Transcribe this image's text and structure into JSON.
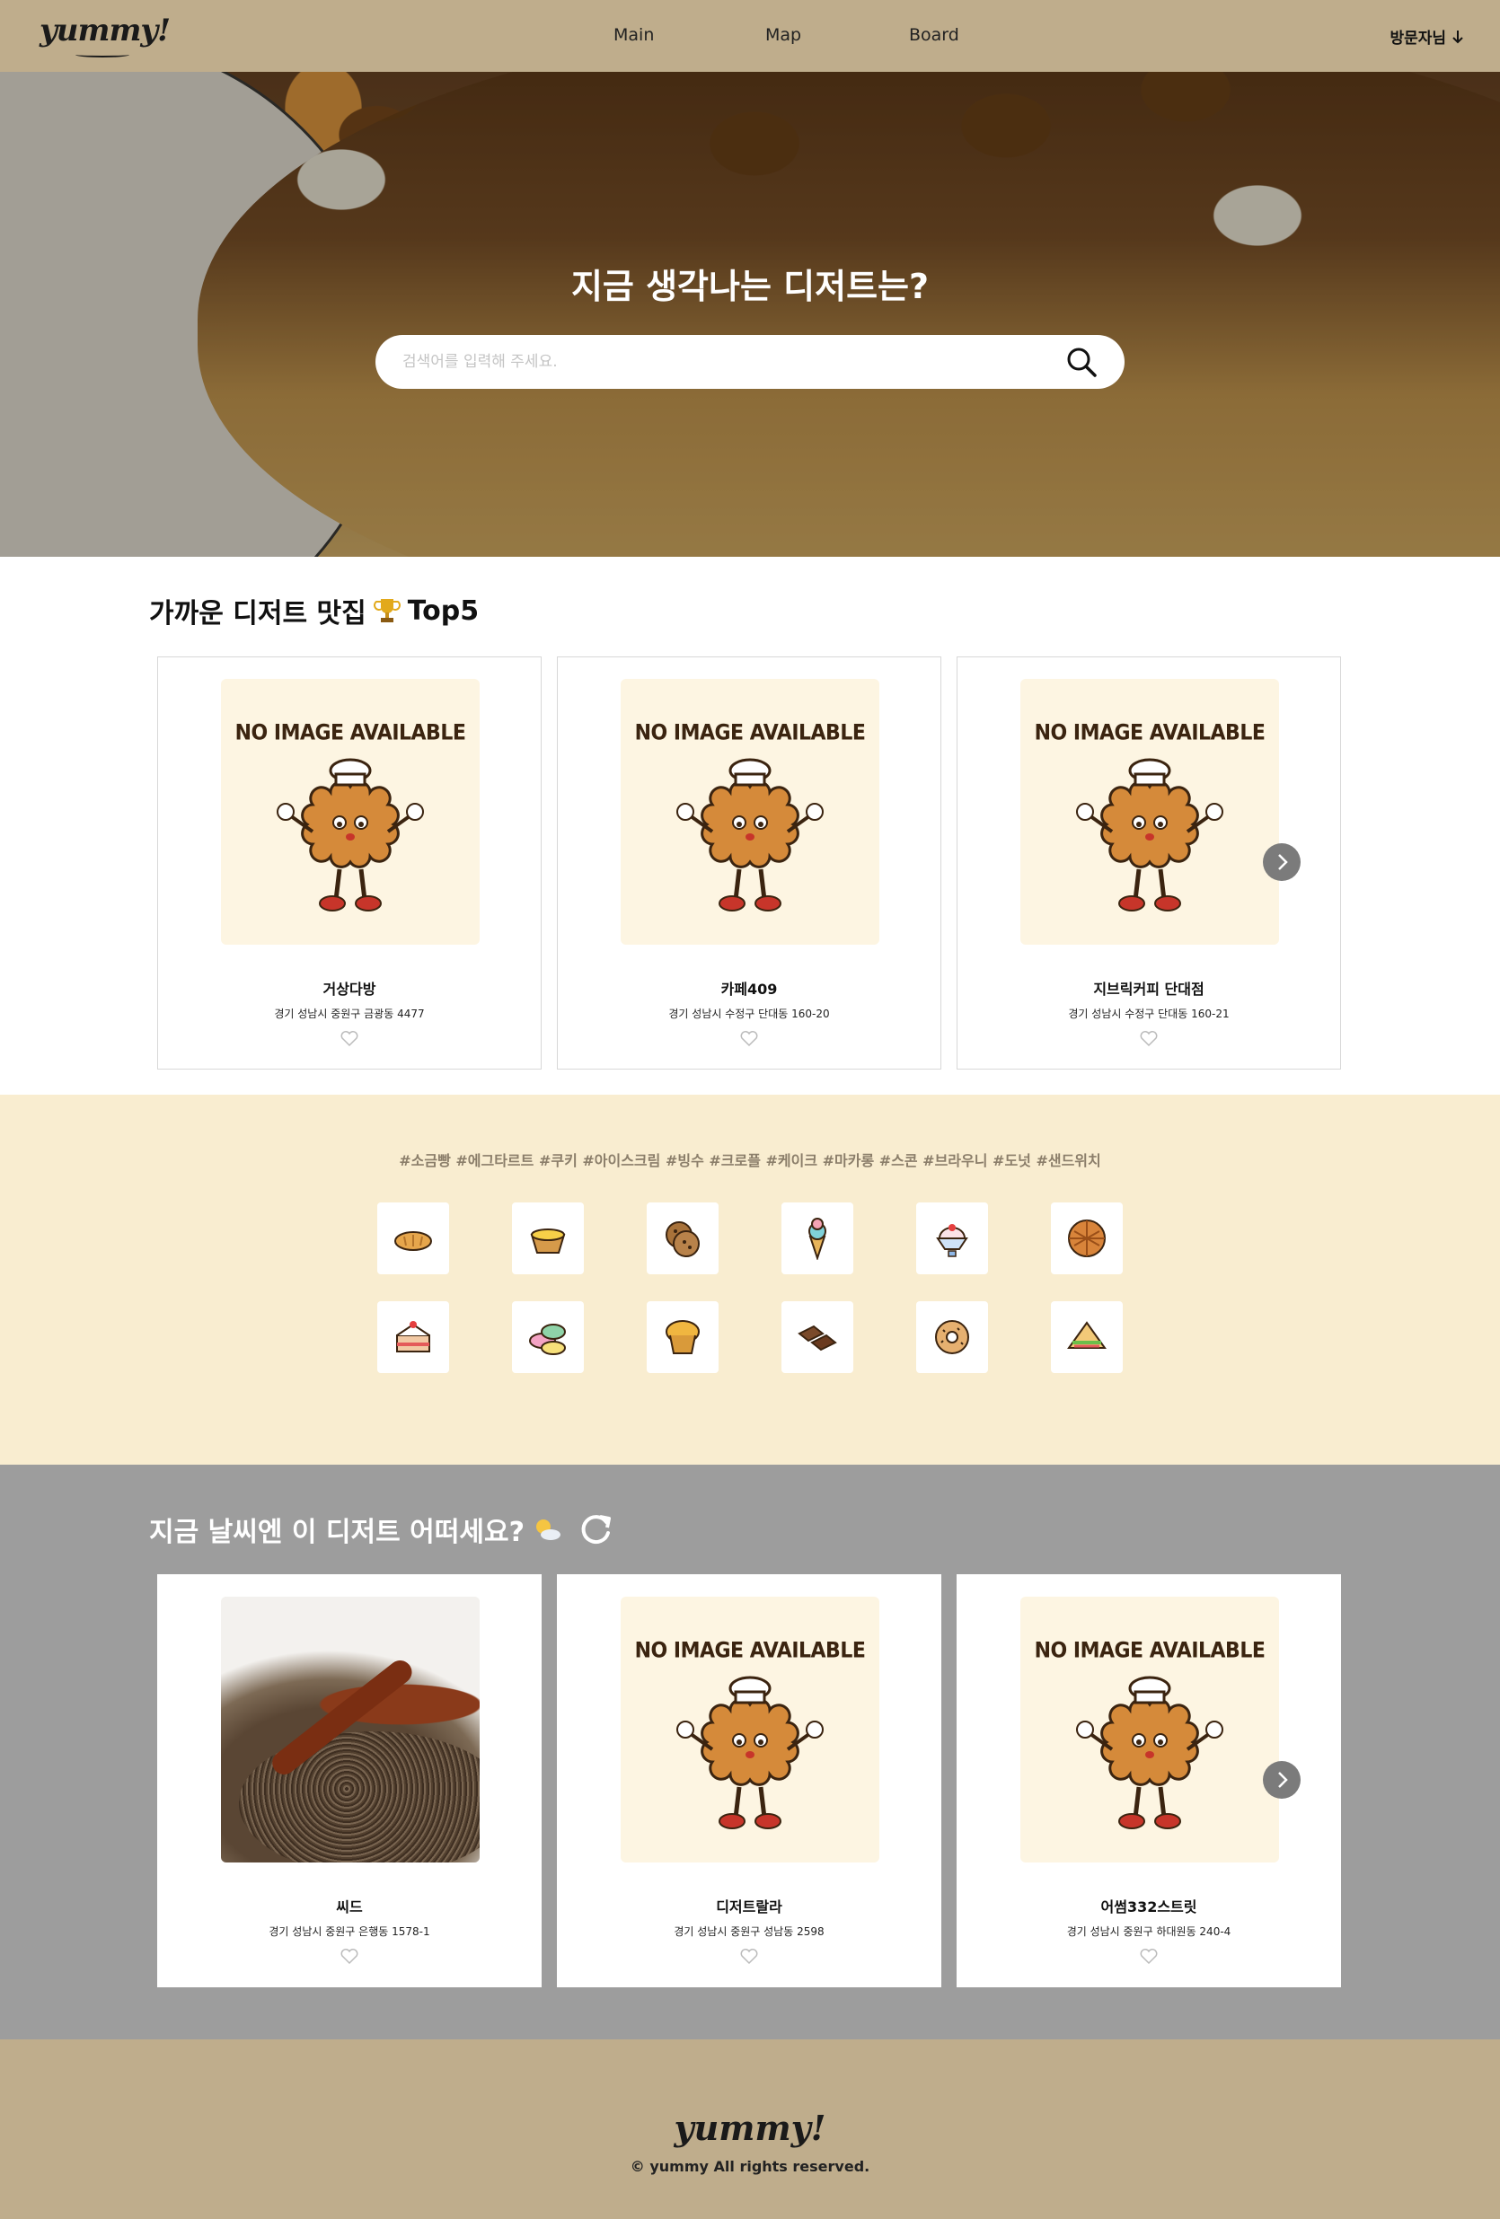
{
  "header": {
    "logo": "yummy!",
    "nav": [
      "Main",
      "Map",
      "Board"
    ],
    "user_menu": "방문자님"
  },
  "hero": {
    "title": "지금 생각나는 디저트는?",
    "search_placeholder": "검색어를 입력해 주세요."
  },
  "top5": {
    "title": "가까운 디저트 맛집",
    "title_suffix": "Top5",
    "trophy_icon": "trophy-icon",
    "cards": [
      {
        "image": "NO IMAGE AVAILABLE",
        "name": "거상다방",
        "address": "경기 성남시 중원구 금광동 4477"
      },
      {
        "image": "NO IMAGE AVAILABLE",
        "name": "카페409",
        "address": "경기 성남시 수정구 단대동 160-20"
      },
      {
        "image": "NO IMAGE AVAILABLE",
        "name": "지브릭커피 단대점",
        "address": "경기 성남시 수정구 단대동 160-21"
      }
    ]
  },
  "tags": {
    "line": "#소금빵 #에그타르트 #쿠키 #아이스크림 #빙수 #크로플 #케이크 #마카롱 #스콘 #브라우니 #도넛 #샌드위치",
    "icons": [
      "salt-bread-icon",
      "egg-tart-icon",
      "cookie-icon",
      "ice-cream-icon",
      "bingsu-icon",
      "croffle-icon",
      "cake-icon",
      "macaron-icon",
      "scone-icon",
      "brownie-icon",
      "donut-icon",
      "sandwich-icon"
    ]
  },
  "weather": {
    "title": "지금 날씨엔 이 디저트 어떠세요?",
    "weather_icon": "partly-sunny-icon",
    "cards": [
      {
        "image": "seed-photo",
        "name": "씨드",
        "address": "경기 성남시 중원구 은행동 1578-1"
      },
      {
        "image": "NO IMAGE AVAILABLE",
        "name": "디저트랄라",
        "address": "경기 성남시 중원구 성남동 2598"
      },
      {
        "image": "NO IMAGE AVAILABLE",
        "name": "어썸332스트릿",
        "address": "경기 성남시 중원구 하대원동 240-4"
      }
    ]
  },
  "footer": {
    "logo": "yummy!",
    "copyright": "© yummy All rights reserved."
  },
  "colors": {
    "header_bg": "#bfad8c",
    "tags_bg": "#f9edd0",
    "weather_bg": "#9d9d9d",
    "card_image_bg": "#fdf5e2"
  }
}
